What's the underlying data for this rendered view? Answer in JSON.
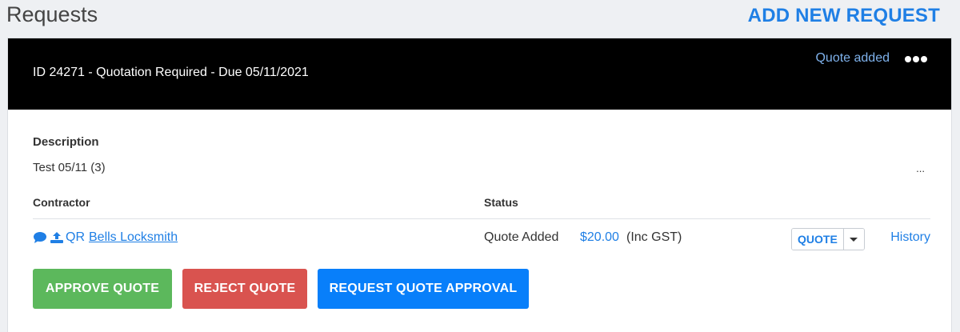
{
  "page": {
    "title": "Requests",
    "add_new_label": "ADD NEW REQUEST"
  },
  "request": {
    "title": "ID 24271 - Quotation Required - Due 05/11/2021",
    "header_status": "Quote added",
    "description_label": "Description",
    "description_value": "Test 05/11 (3)",
    "description_more": "...",
    "columns": {
      "contractor": "Contractor",
      "status": "Status"
    },
    "row": {
      "contractor_prefix": "QR",
      "contractor_name": "Bells Locksmith",
      "status": "Quote Added",
      "amount": "$20.00",
      "amount_suffix": "(Inc GST)",
      "quote_label": "QUOTE",
      "history_label": "History"
    },
    "actions": {
      "approve": "APPROVE QUOTE",
      "reject": "REJECT QUOTE",
      "request_approval": "REQUEST QUOTE APPROVAL"
    }
  },
  "icons": {
    "message": "chat-bubble-icon",
    "upload": "upload-icon",
    "more": "more-dots-icon",
    "caret": "caret-down-icon"
  },
  "colors": {
    "accent": "#1f7fe5",
    "approve": "#5cb85c",
    "reject": "#d9534f",
    "request": "#087ffa",
    "header_bg": "#000000"
  }
}
